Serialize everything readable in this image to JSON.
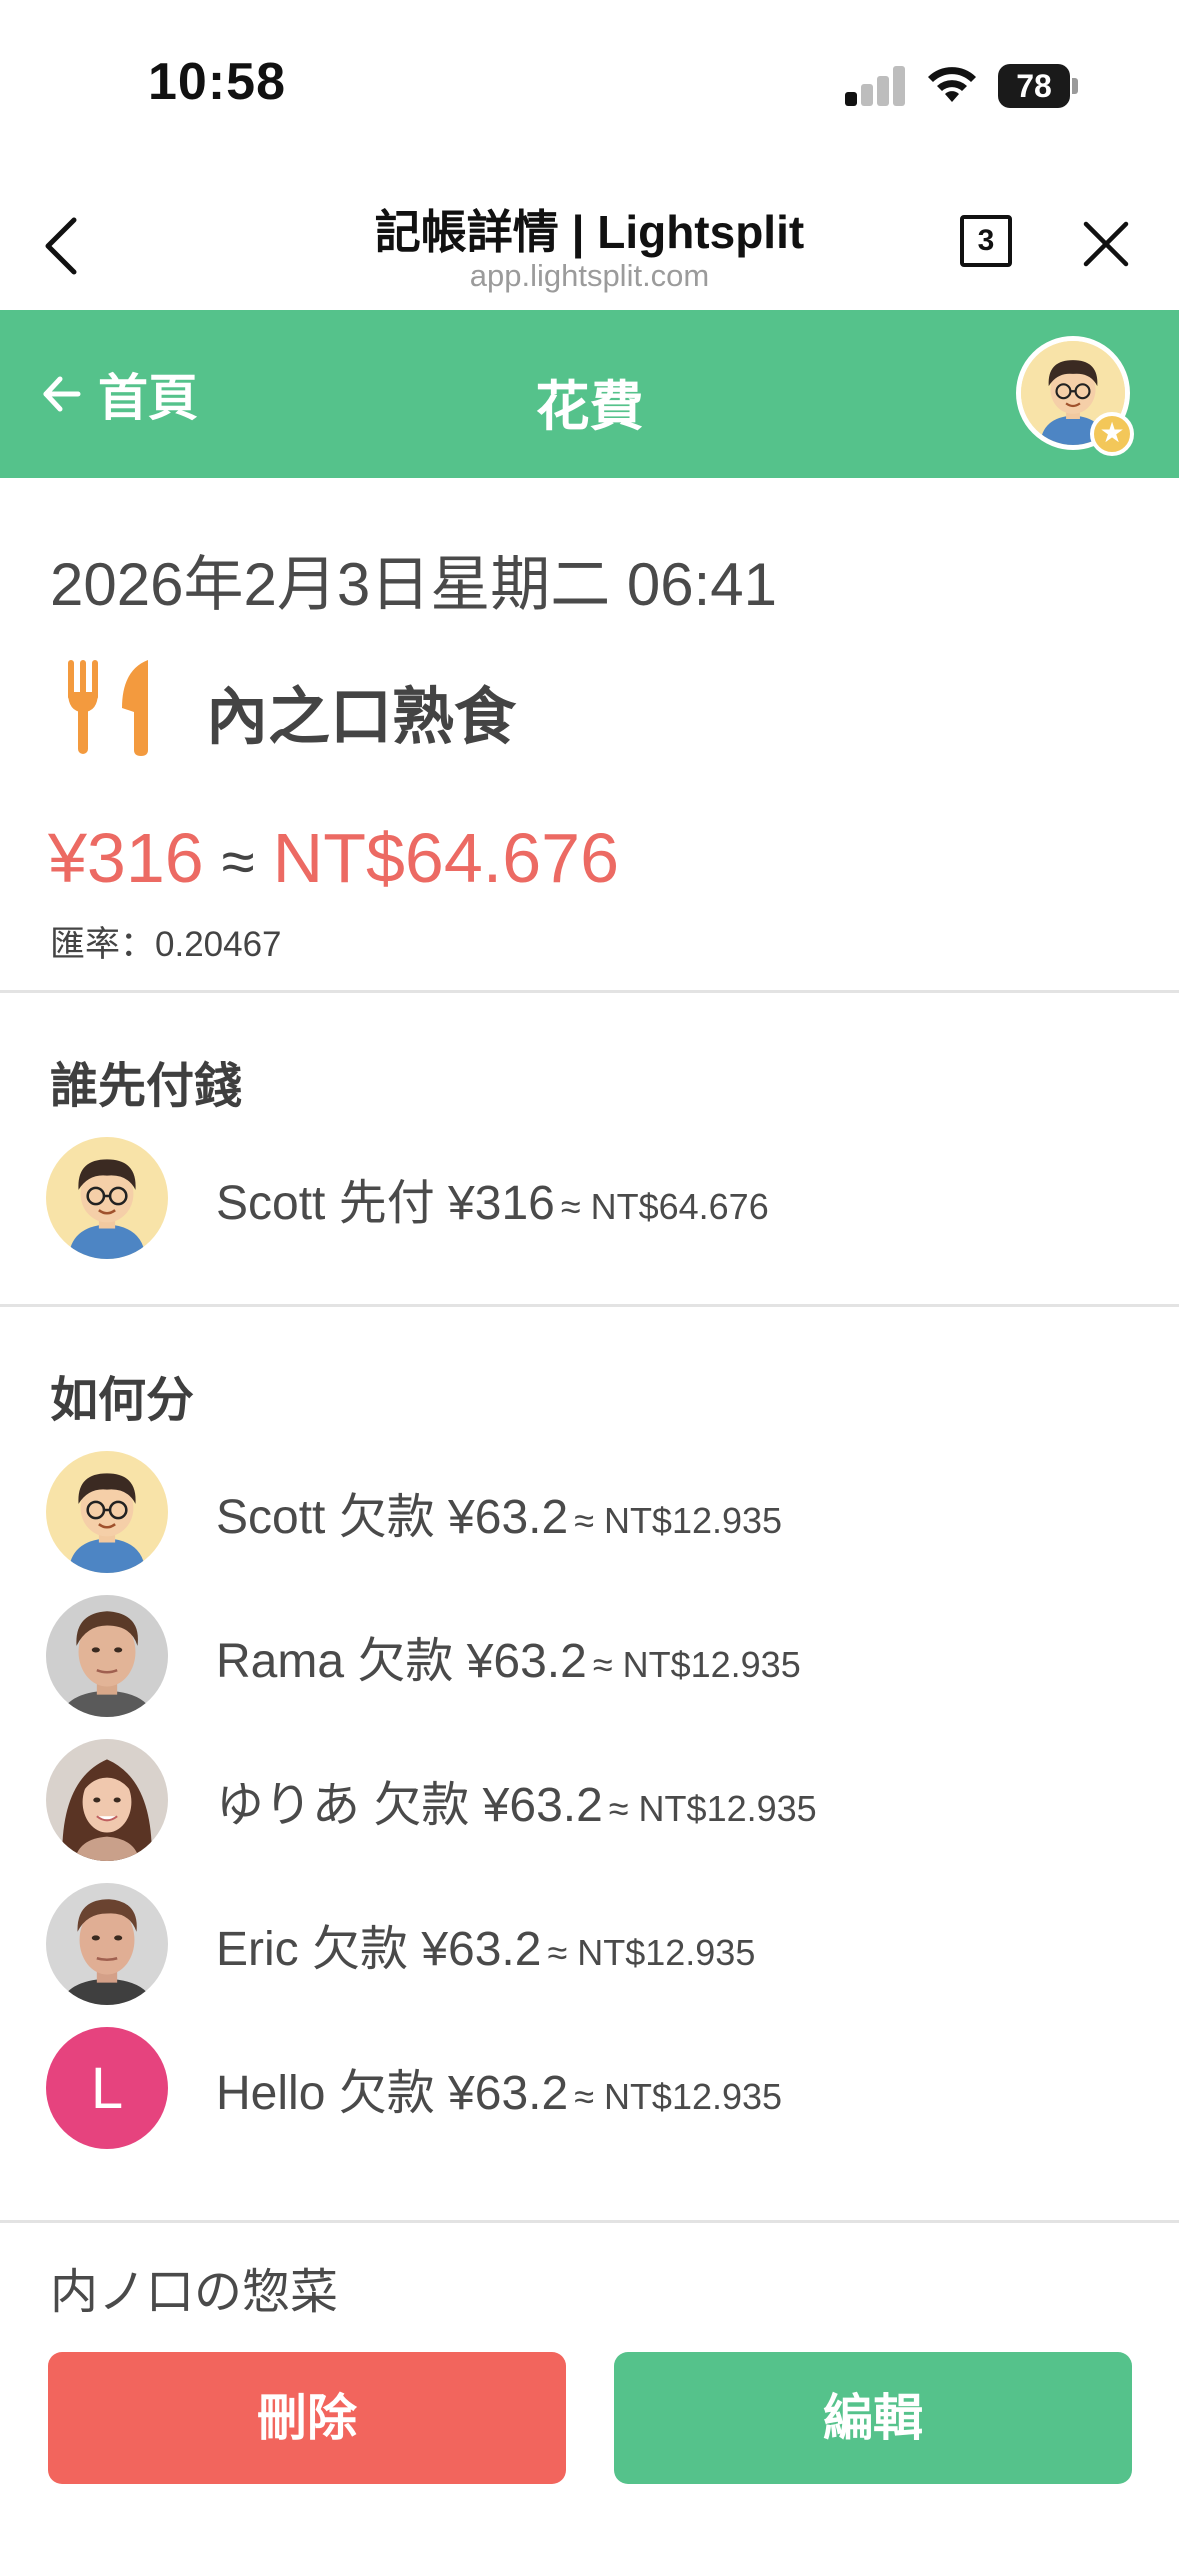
{
  "status_bar": {
    "time": "10:58",
    "battery": "78"
  },
  "browser": {
    "title": "記帳詳情 | Lightsplit",
    "url": "app.lightsplit.com",
    "tab_count": "3"
  },
  "header": {
    "home_label": "首頁",
    "title": "花費",
    "accent_color": "#55c28b"
  },
  "expense": {
    "datetime": "2026年2月3日星期二 06:41",
    "category_icon": "fork-knife-icon",
    "name": "內之口熟食",
    "amount_original": "¥316",
    "approx_sign": "≈",
    "amount_converted": "NT$64.676",
    "rate": "匯率：0.20467",
    "amount_color": "#ec6a63"
  },
  "payer_section": {
    "title": "誰先付錢",
    "payer": {
      "name": "Scott",
      "text": "Scott 先付 ¥316",
      "conv": "≈ NT$64.676"
    }
  },
  "split_section": {
    "title": "如何分",
    "members": [
      {
        "text": "Scott 欠款 ¥63.2",
        "conv": "≈ NT$12.935"
      },
      {
        "text": "Rama 欠款 ¥63.2",
        "conv": "≈ NT$12.935"
      },
      {
        "text": "ゆりあ 欠款 ¥63.2",
        "conv": "≈ NT$12.935"
      },
      {
        "text": "Eric 欠款 ¥63.2",
        "conv": "≈ NT$12.935"
      },
      {
        "text": "Hello 欠款 ¥63.2",
        "conv": "≈ NT$12.935",
        "initial": "L"
      }
    ]
  },
  "note": "内ノ口の惣菜",
  "actions": {
    "delete_label": "刪除",
    "edit_label": "編輯",
    "delete_color": "#f2655d",
    "edit_color": "#55c28b"
  }
}
